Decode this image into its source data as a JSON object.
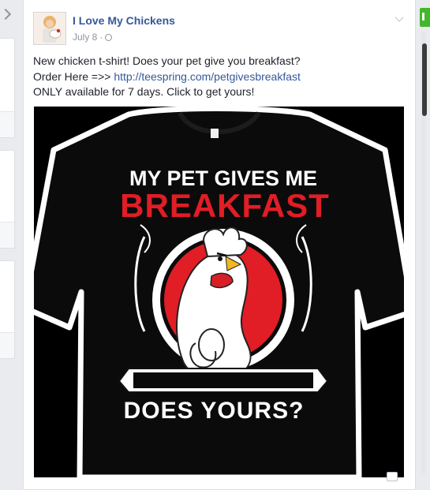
{
  "post": {
    "author": "I Love My Chickens",
    "date": "July 8",
    "date_separator": " · ",
    "text_line1": "New chicken t-shirt! Does your pet give you breakfast?",
    "text_line2_prefix": "Order Here =>> ",
    "link": "http://teespring.com/petgivesbreakfast",
    "text_line3": "ONLY available for 7 days. Click to get yours!",
    "photo": {
      "shirt_line1": "MY PET GIVES ME",
      "shirt_line2": "BREAKFAST",
      "shirt_line3": "DOES YOURS?"
    }
  },
  "colors": {
    "link": "#365899",
    "shirt_red": "#e11d25",
    "shirt_black": "#0b0b0b"
  },
  "icons": {
    "privacy": "globe-icon",
    "post_menu": "chevron-down-icon"
  }
}
